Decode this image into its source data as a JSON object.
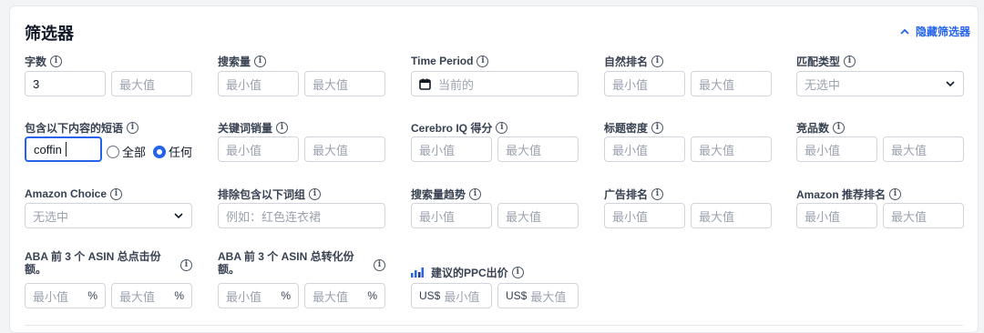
{
  "header": {
    "title": "筛选器",
    "hide_label": "隐藏筛选器"
  },
  "ph": {
    "min": "最小值",
    "max": "最大值",
    "none": "无选中"
  },
  "row1": {
    "char_count": {
      "label": "字数",
      "min_value": "3"
    },
    "search_volume": {
      "label": "搜索量"
    },
    "time_period": {
      "label": "Time Period",
      "value": "当前的"
    },
    "organic_rank": {
      "label": "自然排名"
    },
    "match_type": {
      "label": "匹配类型"
    }
  },
  "row2": {
    "phrase_contains": {
      "label": "包含以下内容的短语",
      "value": "coffin",
      "opt_all": "全部",
      "opt_any": "任何"
    },
    "keyword_sales": {
      "label": "关键词销量"
    },
    "cerebro_iq": {
      "label": "Cerebro IQ 得分"
    },
    "title_density": {
      "label": "标题密度"
    },
    "competing": {
      "label": "竞品数"
    }
  },
  "row3": {
    "amazon_choice": {
      "label": "Amazon Choice"
    },
    "exclude_phrase": {
      "label": "排除包含以下词组",
      "placeholder": "例如：红色连衣裙"
    },
    "sv_trend": {
      "label": "搜索量趋势"
    },
    "ad_rank": {
      "label": "广告排名"
    },
    "amazon_rec_rank": {
      "label": "Amazon 推荐排名"
    }
  },
  "row4": {
    "aba_click": {
      "label": "ABA 前 3 个 ASIN 总点击份额。",
      "suffix": "%"
    },
    "aba_conv": {
      "label": "ABA 前 3 个 ASIN 总转化份额。",
      "suffix": "%"
    },
    "ppc": {
      "label": "建议的PPC出价",
      "currency": "US$"
    }
  },
  "colors": {
    "accent": "#2563eb",
    "border": "#d1d5db"
  }
}
